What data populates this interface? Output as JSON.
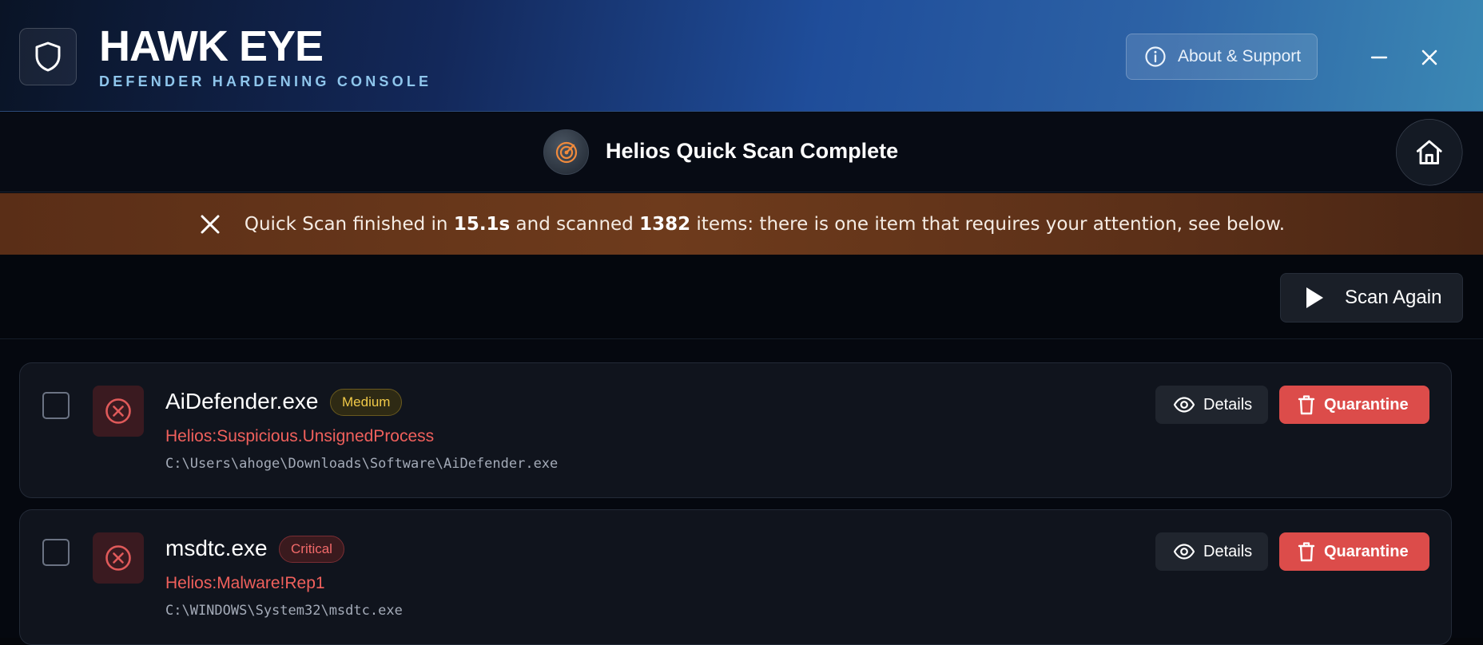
{
  "header": {
    "title": "HAWK EYE",
    "subtitle": "DEFENDER HARDENING CONSOLE",
    "logo_icon": "shield-icon",
    "about_label": "About & Support",
    "about_icon": "info-icon",
    "minimize_icon": "minimize-icon",
    "close_icon": "close-icon"
  },
  "scan": {
    "title": "Helios Quick Scan Complete",
    "status_icon": "radar-icon",
    "home_icon": "home-icon"
  },
  "alert": {
    "prefix": "Quick Scan finished in ",
    "duration": "15.1s",
    "middle": " and scanned ",
    "count": "1382",
    "suffix": " items: there is one item that requires your attention, see below.",
    "dismiss_icon": "close-icon",
    "background_color": "#6e3b1c"
  },
  "toolbar": {
    "scan_again_label": "Scan Again",
    "scan_again_icon": "play-icon"
  },
  "results": [
    {
      "file_name": "AiDefender.exe",
      "severity": "Medium",
      "severity_color": "#f0c948",
      "threat_name": "Helios:Suspicious.UnsignedProcess",
      "path": "C:\\Users\\ahoge\\Downloads\\Software\\AiDefender.exe",
      "details_label": "Details",
      "quarantine_label": "Quarantine",
      "checked": false
    },
    {
      "file_name": "msdtc.exe",
      "severity": "Critical",
      "severity_color": "#f26a6a",
      "threat_name": "Helios:Malware!Rep1",
      "path": "C:\\WINDOWS\\System32\\msdtc.exe",
      "details_label": "Details",
      "quarantine_label": "Quarantine",
      "checked": false
    }
  ],
  "colors": {
    "accent_red": "#dc4c4a",
    "subtitle_blue": "#8fc6ec",
    "radar_orange": "#f08a3c"
  }
}
